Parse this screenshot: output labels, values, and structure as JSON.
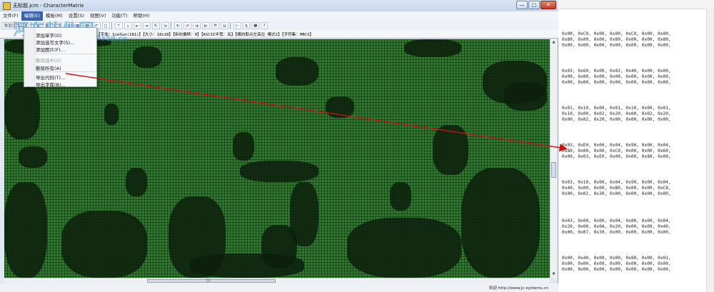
{
  "window": {
    "title": "无标题.jcm - CharacterMatrix",
    "buttons": {
      "minimize": "—",
      "maximize": "□",
      "close": "✕"
    }
  },
  "menubar": {
    "items": [
      "文件(F)",
      "编辑(E)",
      "模板(M)",
      "设置(S)",
      "视图(V)",
      "功能(T)",
      "帮助(H)"
    ],
    "active_index": 1
  },
  "toolbar": {
    "items": [
      "添加字库(D)",
      "A",
      "B",
      "C",
      "◲",
      "⊠",
      "⊟",
      "↶",
      "◻",
      "⇡",
      "⇣",
      "⇤",
      "⇥",
      "⇱",
      "⇲",
      "↻",
      "↺",
      "⇉",
      "⇇",
      "⇈",
      "⇊",
      "⊢",
      "$",
      "❶",
      "?"
    ]
  },
  "infobar": {
    "text": "【字体：SimSun(181)】【大小：18x18】【纵向偏移：0】【ASCII半宽：关】【横向取点左高位 模式1】【字符集：MBCS】"
  },
  "context_menu": {
    "items": [
      {
        "label": "添加单字(O)",
        "disabled": false
      },
      {
        "label": "添加选写文字(S)...",
        "disabled": false
      },
      {
        "label": "添加图片(F)...",
        "disabled": false
      },
      {
        "label": "删除选中(D)",
        "disabled": true
      },
      {
        "label": "删除所有(A)",
        "disabled": false
      },
      {
        "label": "导出代码(T)...",
        "disabled": false
      },
      {
        "label": "导出字库(B)...",
        "disabled": false
      }
    ]
  },
  "watermark": {
    "text": "河东软件园",
    "url": "www.pc0359.cn"
  },
  "statusbar": {
    "text": "欢迎  http://www.jc-systems.cn"
  },
  "hscroll_grip": "|||",
  "code_blocks": [
    "0x00, 0xC0, 0x00, 0x00, 0xC0, 0x00, 0x00,\n0x80, 0x00, 0x00, 0x80, 0x00, 0x00, 0x80,\n0x00, 0x00, 0x00, 0x00, 0x00, 0x00, 0x00,",
    "0x03, 0x60, 0x00, 0x02, 0x40, 0x00, 0x00,\n0x00, 0x00, 0x00, 0x00, 0x00, 0x00, 0x00,\n0x00, 0x00, 0x00, 0x00, 0x00, 0x00, 0x00,",
    "0x01, 0x10, 0x00, 0x01, 0x10, 0x00, 0x01,\n0x10, 0x00, 0x02, 0x20, 0x00, 0x02, 0x20,\n0x00, 0x02, 0x20, 0x00, 0x00, 0x00, 0x00,",
    "0x03, 0xE0, 0x00, 0x04, 0x90, 0x00, 0x04,\n0x80, 0x00, 0x00, 0xC0, 0x00, 0x00, 0x60,\n0x00, 0x03, 0xE0, 0x00, 0x00, 0x80, 0x00,",
    "0x03, 0x10, 0x00, 0x04, 0x90, 0x00, 0x04,\n0x40, 0x00, 0x00, 0xB0, 0x00, 0x00, 0xC8,\n0x00, 0x02, 0x30, 0x00, 0x00, 0x00, 0x00,",
    "0x03, 0x00, 0x00, 0x04, 0x80, 0x00, 0x04,\n0x20, 0x00, 0x0A, 0x20, 0x00, 0x09, 0x40,\n0x00, 0x07, 0x30, 0x00, 0x00, 0x00, 0x00,",
    "0x00, 0x40, 0x00, 0x00, 0x80, 0x00, 0x01,\n0x00, 0x00, 0x00, 0x00, 0x00, 0x00, 0x00,\n0x00, 0x00, 0x00, 0x00, 0x00, 0x00, 0x00,"
  ],
  "colors": {
    "matrix_on": "#2f7a2f",
    "matrix_off": "#0c1f0c",
    "arrow": "#cc1111"
  }
}
